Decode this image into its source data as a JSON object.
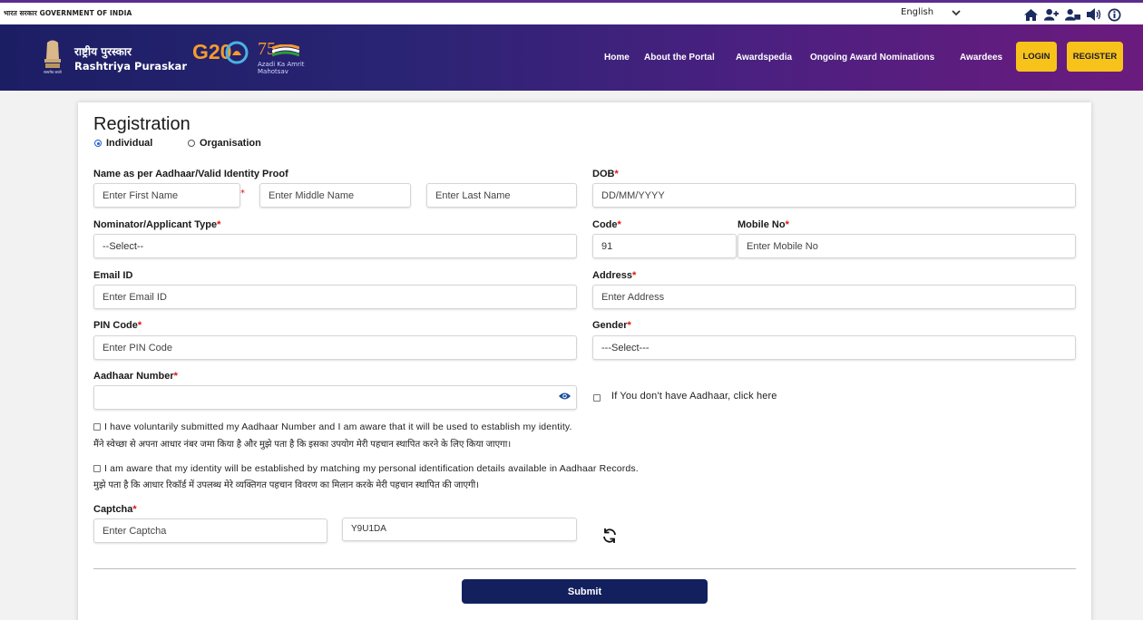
{
  "topbar": {
    "gov_text": "भारत सरकार GOVERNMENT OF INDIA",
    "language": "English",
    "icons": [
      "home-icon",
      "add-user-icon",
      "users-icon",
      "speaker-icon",
      "info-icon"
    ]
  },
  "header": {
    "brand_hindi": "राष्ट्रीय पुरस्कार",
    "brand_english": "Rashtriya Puraskar",
    "g20_text": "G20",
    "azadi_number": "75",
    "azadi_text": "Azadi Ka Amrit Mahotsav",
    "nav": [
      "Home",
      "About the Portal",
      "Awardspedia",
      "Ongoing Award Nominations",
      "Awardees"
    ],
    "login_label": "LOGIN",
    "register_label": "REGISTER",
    "colors": {
      "gradient_start": "#1c1e64",
      "gradient_end": "#6b1b7e",
      "button": "#f7c31a"
    }
  },
  "form": {
    "title": "Registration",
    "type_options": [
      "Individual",
      "Organisation"
    ],
    "selected_type": "Individual",
    "name_label": "Name as per Aadhaar/Valid Identity Proof",
    "first_name_placeholder": "Enter First Name",
    "middle_name_placeholder": "Enter Middle Name",
    "last_name_placeholder": "Enter Last Name",
    "dob_label": "DOB",
    "dob_placeholder": "DD/MM/YYYY",
    "nominator_label": "Nominator/Applicant Type",
    "nominator_selected": "--Select--",
    "code_label": "Code",
    "code_value": "91",
    "mobile_label": "Mobile No",
    "mobile_placeholder": "Enter Mobile No",
    "email_label": "Email ID",
    "email_placeholder": "Enter Email ID",
    "address_label": "Address",
    "address_placeholder": "Enter Address",
    "pin_label": "PIN Code",
    "pin_placeholder": "Enter PIN Code",
    "gender_label": "Gender",
    "gender_selected": "---Select---",
    "aadhaar_label": "Aadhaar Number",
    "aadhaar_value": "",
    "no_aadhaar_text": "If You don't have Aadhaar, click here",
    "consent1_en": "I have voluntarily submitted my Aadhaar Number and I am aware that it will be used to establish my identity.",
    "consent1_hi": "मैंने स्वेच्छा से अपना आधार नंबर जमा किया है और मुझे पता है कि इसका उपयोग मेरी पहचान स्थापित करने के लिए किया जाएगा।",
    "consent2_en": "I am aware that my identity will be established by matching my personal identification details available in Aadhaar Records.",
    "consent2_hi": "मुझे पता है कि आधार रिकॉर्ड में उपलब्ध मेरे व्यक्तिगत पहचान विवरण का मिलान करके मेरी पहचान स्थापित की जाएगी।",
    "captcha_label": "Captcha",
    "captcha_placeholder": "Enter Captcha",
    "captcha_code": "Y9U1DA",
    "submit_label": "Submit",
    "required_mark": "*"
  }
}
